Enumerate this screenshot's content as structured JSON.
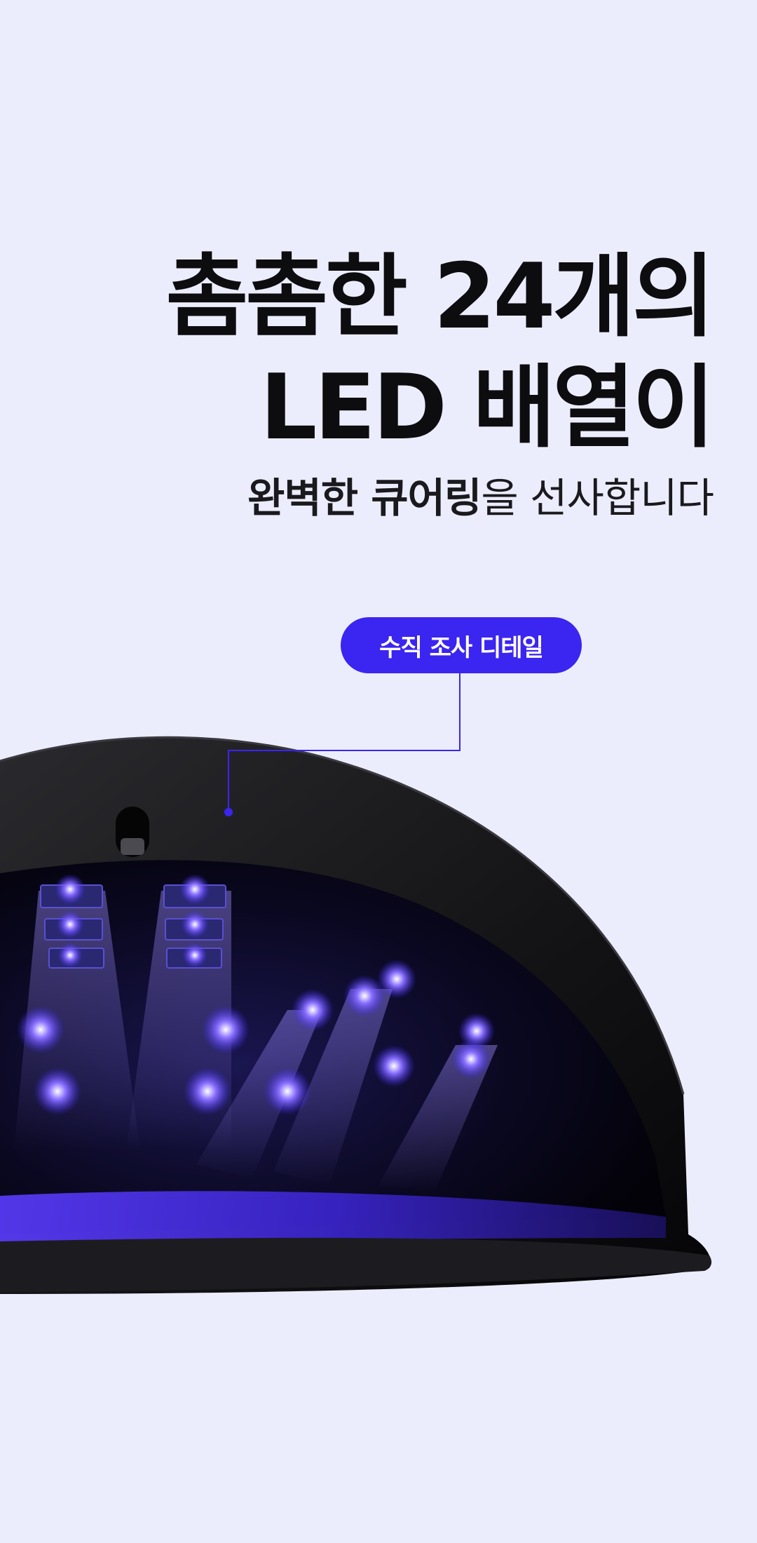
{
  "headline": {
    "line1": "촘촘한 24개의",
    "line2": "LED 배열이"
  },
  "subline": {
    "bold": "완벽한 큐어링",
    "light": "을 선사합니다"
  },
  "callout": {
    "label": "수직 조사 디테일",
    "accent_color": "#3b25f0"
  },
  "colors": {
    "background": "#ecedfc",
    "lamp_body": "#141416",
    "led_glow": "#5a3cff"
  }
}
